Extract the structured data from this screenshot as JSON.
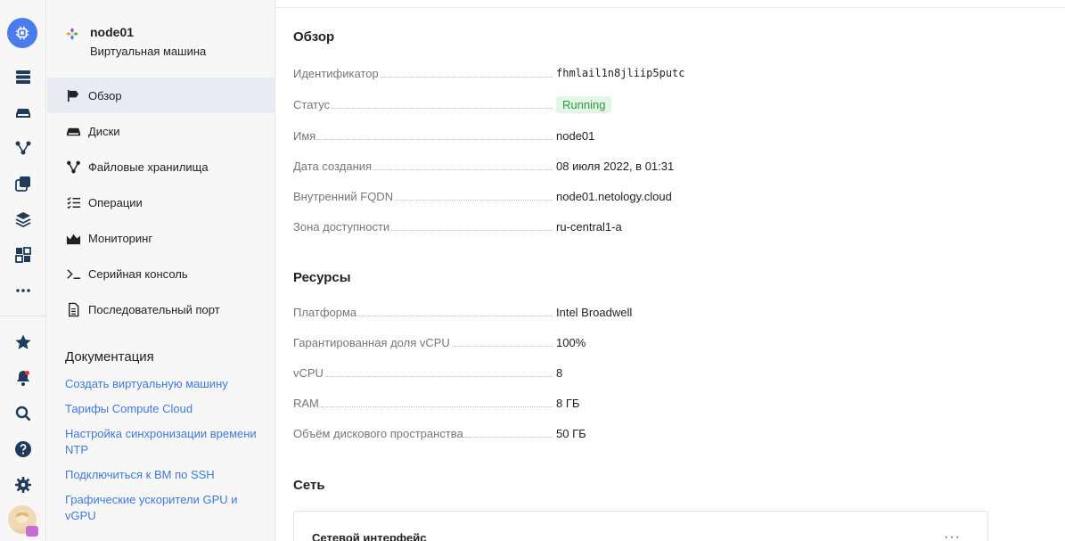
{
  "rail": {
    "icons": [
      "compute-icon",
      "servers-icon",
      "disk-icon",
      "network-icon",
      "copy-icon",
      "layers-icon",
      "grid-icon",
      "more-icon",
      "star-icon",
      "bell-icon",
      "search-icon",
      "help-icon",
      "settings-icon"
    ]
  },
  "vm": {
    "name": "node01",
    "subtitle": "Виртуальная машина"
  },
  "nav": {
    "items": [
      {
        "label": "Обзор",
        "icon": "flag-icon"
      },
      {
        "label": "Диски",
        "icon": "disk-icon"
      },
      {
        "label": "Файловые хранилища",
        "icon": "file-storage-icon"
      },
      {
        "label": "Операции",
        "icon": "operations-icon"
      },
      {
        "label": "Мониторинг",
        "icon": "monitoring-icon"
      },
      {
        "label": "Серийная консоль",
        "icon": "console-icon"
      },
      {
        "label": "Последовательный порт",
        "icon": "document-icon"
      }
    ],
    "active_index": 0
  },
  "docs": {
    "title": "Документация",
    "links": [
      "Создать виртуальную машину",
      "Тарифы Compute Cloud",
      "Настройка синхронизации времени NTP",
      "Подключиться к ВМ по SSH",
      "Графические ускорители GPU и vGPU"
    ]
  },
  "overview": {
    "title": "Обзор",
    "rows": [
      {
        "key": "Идентификатор",
        "value": "fhmlail1n8jliip5putc"
      },
      {
        "key": "Статус",
        "value": "Running"
      },
      {
        "key": "Имя",
        "value": "node01"
      },
      {
        "key": "Дата создания",
        "value": "08 июля 2022, в 01:31"
      },
      {
        "key": "Внутренний FQDN",
        "value": "node01.netology.cloud"
      },
      {
        "key": "Зона доступности",
        "value": "ru-central1-a"
      }
    ]
  },
  "resources": {
    "title": "Ресурсы",
    "rows": [
      {
        "key": "Платформа",
        "value": "Intel Broadwell"
      },
      {
        "key": "Гарантированная доля vCPU",
        "value": "100%"
      },
      {
        "key": "vCPU",
        "value": "8"
      },
      {
        "key": "RAM",
        "value": "8 ГБ"
      },
      {
        "key": "Объём дискового пространства",
        "value": "50 ГБ"
      }
    ]
  },
  "network": {
    "title": "Сеть",
    "card_title": "Сетевой интерфейс",
    "more": "···"
  },
  "colors": {
    "accent": "#4a7cf0",
    "link": "#3f7ad6",
    "status_bg": "#e3f5e6",
    "status_text": "#2a9a3c",
    "active_nav": "#e8ebf2"
  }
}
